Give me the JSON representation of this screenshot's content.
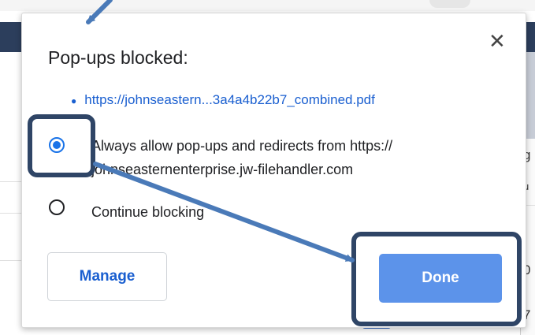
{
  "dialog": {
    "title": "Pop-ups blocked:",
    "close_icon": "close-icon",
    "blocked_link": "https://johnseastern...3a4a4b22b7_combined.pdf",
    "options": [
      {
        "label": "Always allow pop-ups and redirects from https:// johnseasternenterprise.jw-filehandler.com",
        "selected": true
      },
      {
        "label": "Continue blocking",
        "selected": false
      }
    ],
    "manage_label": "Manage",
    "done_label": "Done"
  },
  "background": {
    "right_chars": [
      "g",
      "u",
      "0",
      "7"
    ]
  },
  "annotations": {
    "highlight_color": "#2f4566",
    "arrow_color": "#4a7ab8"
  }
}
